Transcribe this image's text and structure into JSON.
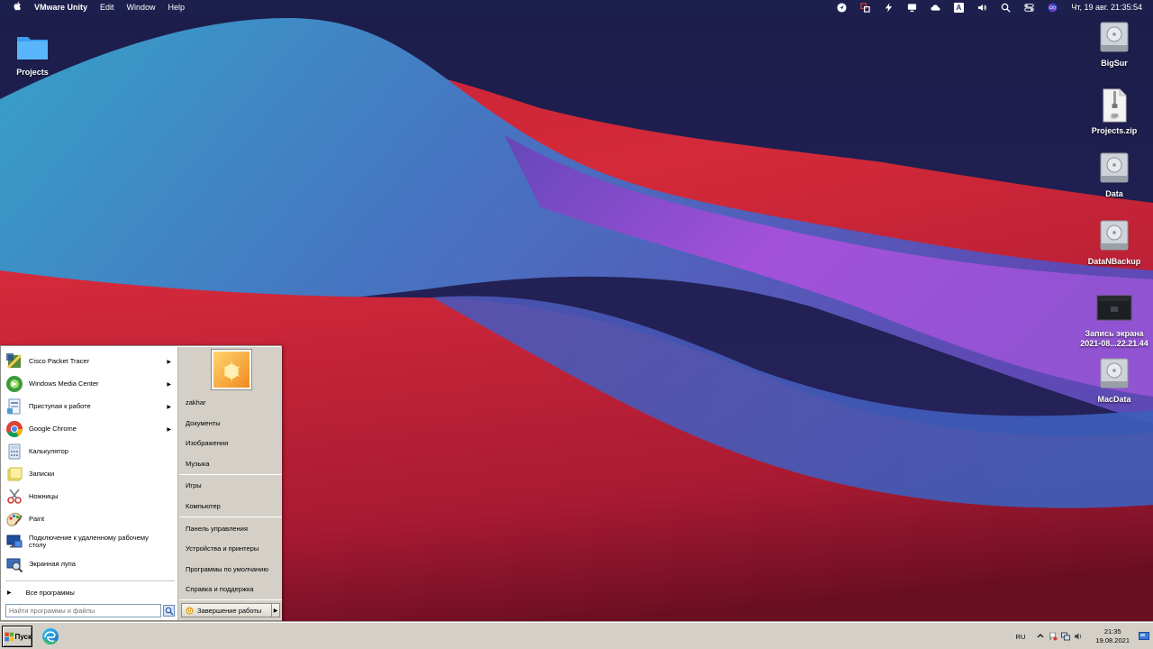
{
  "menubar": {
    "apple": "",
    "app_name": "VMware Unity",
    "items": [
      "Edit",
      "Window",
      "Help"
    ],
    "status_icons": [
      "navigation-icon",
      "vmware-icon",
      "bolt-icon",
      "monitor-icon",
      "cloud-icon",
      "a-icon",
      "volume-icon",
      "search-icon",
      "control-center-icon",
      "siri-icon"
    ],
    "a_glyph": "A",
    "clock": "Чт, 19 авг.  21:35:54"
  },
  "desktop": {
    "projects_folder": "Projects",
    "right_icons": [
      "BigSur",
      "Projects.zip",
      "Data",
      "DataNBackup",
      "Запись экрана\n2021-08...22.21.44",
      "MacData"
    ]
  },
  "start_menu": {
    "programs": [
      {
        "label": "Cisco Packet Tracer",
        "arrow": "▶"
      },
      {
        "label": "Windows Media Center",
        "arrow": "▶"
      },
      {
        "label": "Приступая к работе",
        "arrow": "▶"
      },
      {
        "label": "Google Chrome",
        "arrow": "▶"
      },
      {
        "label": "Калькулятор",
        "arrow": ""
      },
      {
        "label": "Записки",
        "arrow": ""
      },
      {
        "label": "Ножницы",
        "arrow": ""
      },
      {
        "label": "Paint",
        "arrow": ""
      },
      {
        "label": "Подключение к удаленному рабочему столу",
        "arrow": ""
      },
      {
        "label": "Экранная лупа",
        "arrow": ""
      }
    ],
    "all_programs": "Все программы",
    "search_placeholder": "Найти программы и файлы",
    "places": [
      "zakhar",
      "Документы",
      "Изображения",
      "Музыка",
      "Игры",
      "Компьютер",
      "Панель управления",
      "Устройства и принтеры",
      "Программы по умолчанию",
      "Справка и поддержка"
    ],
    "shutdown": "Завершение работы"
  },
  "taskbar": {
    "start": "Пуск",
    "lang": "RU",
    "time": "21:35",
    "date": "19.08.2021"
  }
}
